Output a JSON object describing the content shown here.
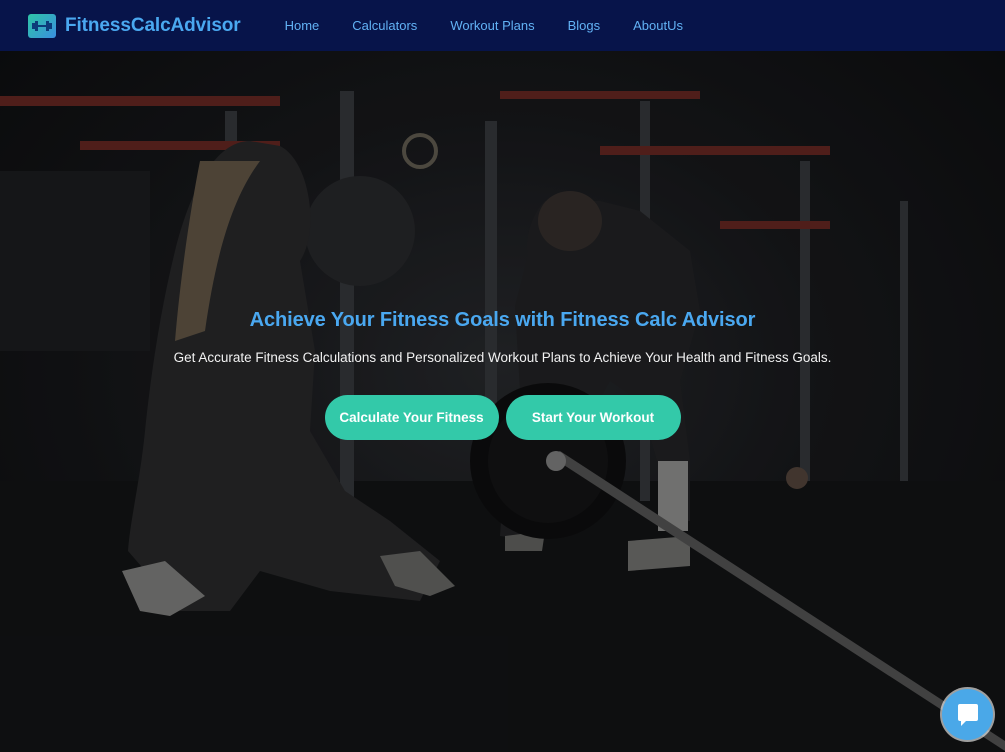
{
  "navbar": {
    "brand": "FitnessCalcAdvisor",
    "links": [
      {
        "label": "Home"
      },
      {
        "label": "Calculators"
      },
      {
        "label": "Workout Plans"
      },
      {
        "label": "Blogs"
      },
      {
        "label": "AboutUs"
      }
    ]
  },
  "hero": {
    "background_image": "gym-workout-photo",
    "title": "Achieve Your Fitness Goals with Fitness Calc Advisor",
    "subtitle": "Get Accurate Fitness Calculations and Personalized Workout Plans to Achieve Your Health and Fitness Goals.",
    "buttons": {
      "primary": "Calculate Your Fitness",
      "secondary": "Start Your Workout"
    }
  },
  "chat": {
    "icon": "chat-bubble-icon"
  },
  "colors": {
    "navbar_bg": "#07144a",
    "brand_blue": "#4aa8f0",
    "accent_teal": "#33c9a9",
    "chat_blue": "#4aa8e8"
  }
}
